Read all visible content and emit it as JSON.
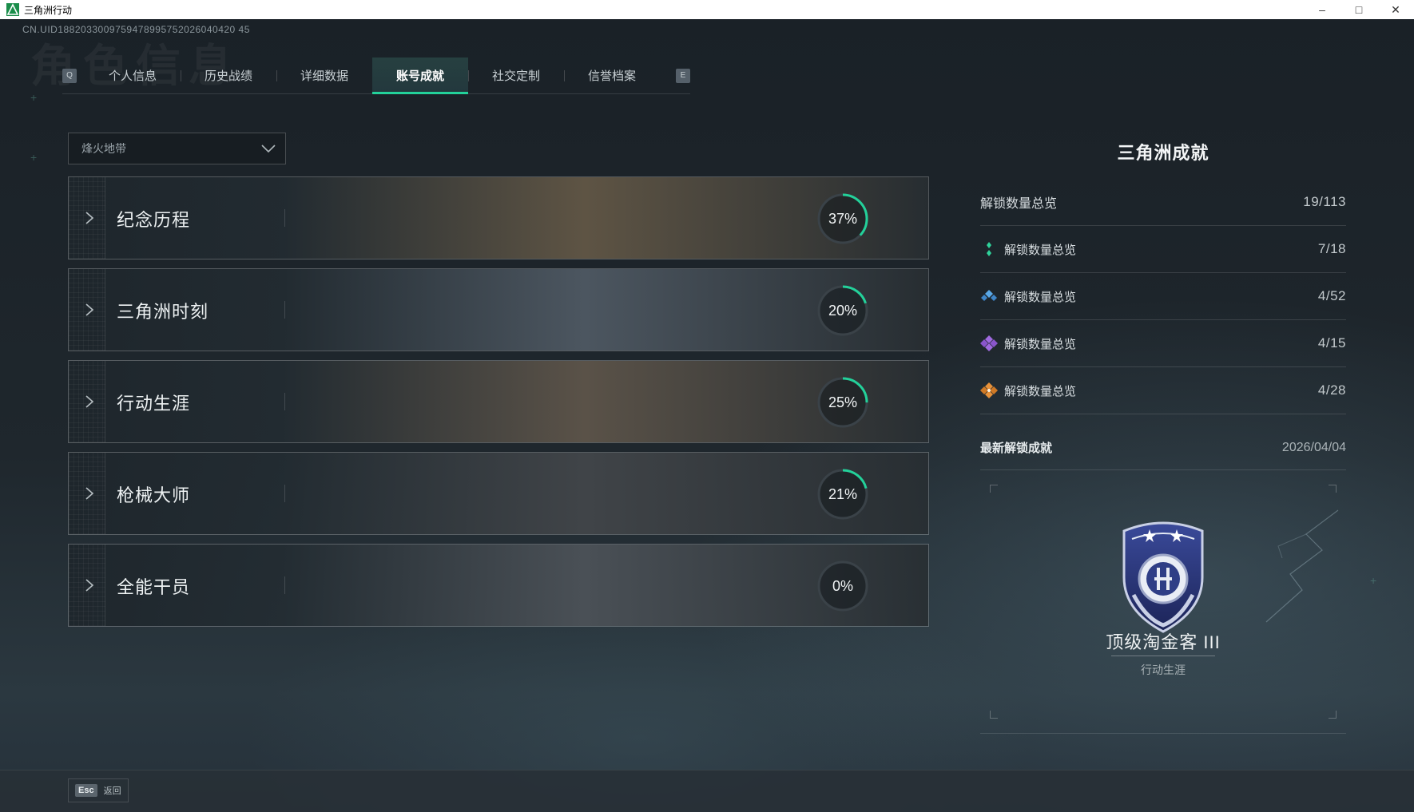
{
  "window": {
    "title": "三角洲行动",
    "controls": {
      "minimize": "–",
      "maximize": "□",
      "close": "✕"
    }
  },
  "header": {
    "uid": "CN.UID1882033009759478995752026040420 45",
    "watermark": "角色信息"
  },
  "tabs": {
    "left_key": "Q",
    "right_key": "E",
    "items": [
      {
        "label": "个人信息"
      },
      {
        "label": "历史战绩"
      },
      {
        "label": "详细数据"
      },
      {
        "label": "账号成就",
        "active": true
      },
      {
        "label": "社交定制"
      },
      {
        "label": "信誉档案"
      }
    ]
  },
  "filter": {
    "selected": "烽火地带"
  },
  "achievements": [
    {
      "name": "纪念历程",
      "percent_text": "37%",
      "percent": 37,
      "theme": "#5e5444"
    },
    {
      "name": "三角洲时刻",
      "percent_text": "20%",
      "percent": 20,
      "theme": "#4c5660"
    },
    {
      "name": "行动生涯",
      "percent_text": "25%",
      "percent": 25,
      "theme": "#5a5248"
    },
    {
      "name": "枪械大师",
      "percent_text": "21%",
      "percent": 21,
      "theme": "#404448"
    },
    {
      "name": "全能干员",
      "percent_text": "0%",
      "percent": 0,
      "theme": "#4a5056"
    }
  ],
  "colors": {
    "accent": "#23d19a",
    "ring_track": "#3a4248",
    "gem_green": "#2fd39b",
    "gem_blue": "#5aa8e6",
    "gem_purple": "#a06ae0",
    "gem_orange": "#e8923a"
  },
  "panel": {
    "title": "三角洲成就",
    "total": {
      "label": "解锁数量总览",
      "value": "19/113"
    },
    "tiers": [
      {
        "icon": "green-gem-icon",
        "label": "解锁数量总览",
        "value": "7/18"
      },
      {
        "icon": "blue-gem-icon",
        "label": "解锁数量总览",
        "value": "4/52"
      },
      {
        "icon": "purple-gem-icon",
        "label": "解锁数量总览",
        "value": "4/15"
      },
      {
        "icon": "orange-gem-icon",
        "label": "解锁数量总览",
        "value": "4/28"
      }
    ],
    "latest": {
      "heading": "最新解锁成就",
      "date": "2026/04/04",
      "name": "顶级淘金客 III",
      "category": "行动生涯"
    }
  },
  "footer": {
    "esc_key": "Esc",
    "esc_label": "返回"
  }
}
